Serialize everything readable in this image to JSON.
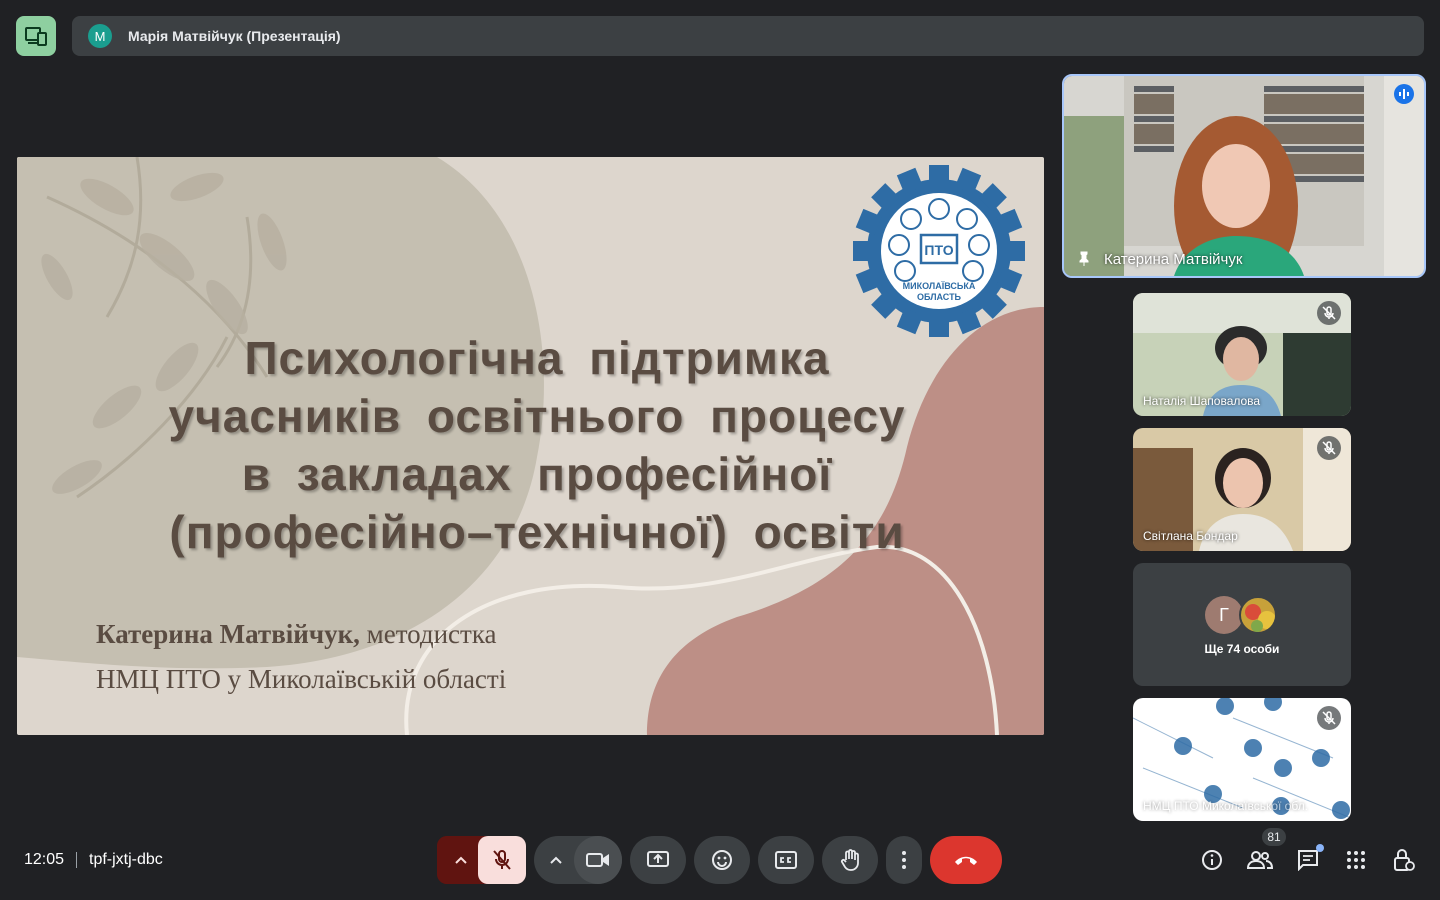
{
  "presenter_banner": {
    "avatar_letter": "M",
    "text": "Марія Матвійчук (Презентація)"
  },
  "slide": {
    "title_lines": [
      "Психологічна підтримка",
      "учасників освітнього процесу",
      "в закладах професійної",
      "(професійно–технічної) освіти"
    ],
    "author_name": "Катерина Матвійчук,",
    "author_role": " методистка",
    "organization": "НМЦ ПТО у Миколаївській області",
    "logo_caption_line1": "МИКОЛАЇВСЬКА",
    "logo_caption_line2": "ОБЛАСТЬ",
    "logo_center": "ПТО"
  },
  "participants": {
    "main_speaker": "Катерина Матвійчук",
    "tiles": [
      {
        "name": "Наталія Шаповалова"
      },
      {
        "name": "Світлана Бондар"
      },
      {
        "name": "НМЦ ПТО Миколаївської обл."
      }
    ],
    "more": {
      "avatar_letter": "Г",
      "label": "Ще 74 особи"
    }
  },
  "bottom_bar": {
    "time": "12:05",
    "meeting_code": "tpf-jxtj-dbc",
    "participant_count": "81"
  },
  "colors": {
    "background": "#202124",
    "end_call": "#dc362e",
    "mic_off": "#f9dedc",
    "accent_border": "#a8c7fa"
  }
}
